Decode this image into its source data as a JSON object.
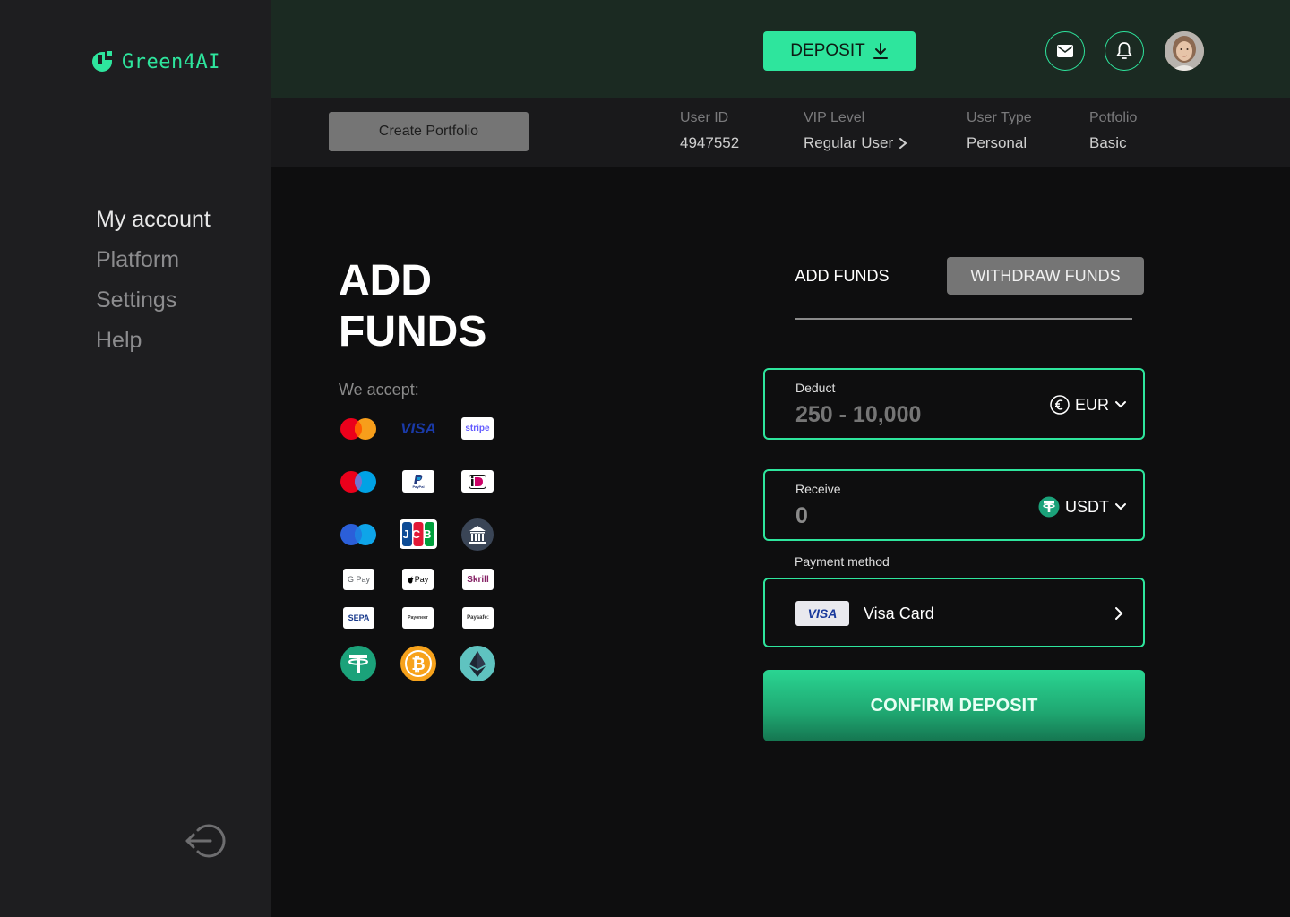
{
  "app": {
    "brand": "Green4AI"
  },
  "sidebar": {
    "items": [
      {
        "label": "My account"
      },
      {
        "label": "Platform"
      },
      {
        "label": "Settings"
      },
      {
        "label": "Help"
      }
    ],
    "logout_icon": "logout-icon"
  },
  "header": {
    "deposit_label": "DEPOSIT",
    "mail_icon": "mail-icon",
    "bell_icon": "bell-icon",
    "avatar_icon": "user-avatar"
  },
  "infobar": {
    "create_portfolio_label": "Create Portfolio",
    "user_id_label": "User ID",
    "user_id_value": "4947552",
    "vip_label": "VIP Level",
    "vip_value": "Regular User",
    "user_type_label": "User Type",
    "user_type_value": "Personal",
    "portfolio_label": "Potfolio",
    "portfolio_value": "Basic"
  },
  "main": {
    "title_line1": "ADD",
    "title_line2": "FUNDS",
    "accept_label": "We accept:",
    "payment_icons": [
      "mastercard-icon",
      "visa-icon",
      "stripe-icon",
      "maestro-icon",
      "paypal-icon",
      "ideal-icon",
      "maestro-blue-icon",
      "jcb-icon",
      "bank-icon",
      "gpay-icon",
      "applepay-icon",
      "skrill-icon",
      "sepa-icon",
      "payoneer-icon",
      "paysafe-icon",
      "tether-icon",
      "bitcoin-icon",
      "ethereum-icon"
    ],
    "visa_text": "VISA",
    "stripe_text": "stripe",
    "jcb_text": "JCB",
    "gpay_text": "G Pay",
    "applepay_text": "Pay",
    "skrill_text": "Skrill",
    "sepa_text": "SEPA",
    "payoneer_text": "Payoneer",
    "paysafe_text": "Paysafe:",
    "paypal_text": "PayPal"
  },
  "form": {
    "tab_add": "ADD FUNDS",
    "tab_withdraw": "WITHDRAW FUNDS",
    "deduct_label": "Deduct",
    "deduct_placeholder": "250 - 10,000",
    "deduct_currency": "EUR",
    "receive_label": "Receive",
    "receive_value": "0",
    "receive_currency": "USDT",
    "payment_method_label": "Payment method",
    "payment_method_badge": "VISA",
    "payment_method_value": "Visa Card",
    "confirm_label": "CONFIRM DEPOSIT"
  },
  "colors": {
    "accent": "#2ee59d",
    "sidebar_bg": "#1e1e20",
    "topbar_bg": "#1b2a22",
    "page_bg": "#0e0e0f"
  }
}
